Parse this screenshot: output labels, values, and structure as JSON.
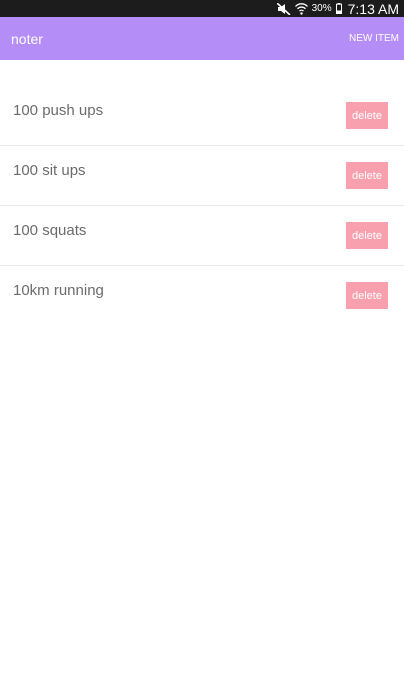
{
  "status_bar": {
    "battery_percent": "30%",
    "time": "7:13 AM",
    "icons": [
      "mute-icon",
      "wifi-icon",
      "battery-icon"
    ]
  },
  "app_bar": {
    "title": "noter",
    "new_item_label": "NEW ITEM",
    "color": "#b48df7"
  },
  "items": [
    {
      "text": "100 push ups",
      "delete_label": "delete"
    },
    {
      "text": "100 sit ups",
      "delete_label": "delete"
    },
    {
      "text": "100 squats",
      "delete_label": "delete"
    },
    {
      "text": "10km running",
      "delete_label": "delete"
    }
  ],
  "colors": {
    "delete_button": "#f8a0ae",
    "item_text": "#6b6b6b",
    "status_bar": "#1c1c1c"
  }
}
